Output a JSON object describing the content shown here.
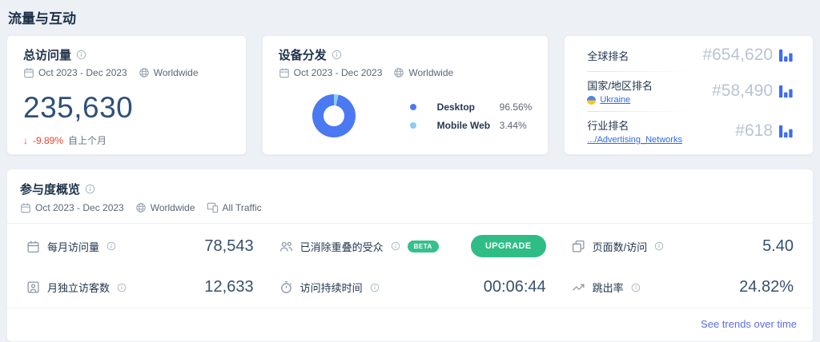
{
  "header": {
    "title": "流量与互动"
  },
  "total_visits": {
    "title": "总访问量",
    "date_range": "Oct 2023 - Dec 2023",
    "region": "Worldwide",
    "value": "235,630",
    "change_arrow": "↓",
    "change": "-9.89%",
    "change_caption": "自上个月"
  },
  "device_distribution": {
    "title": "设备分发",
    "date_range": "Oct 2023 - Dec 2023",
    "region": "Worldwide",
    "legend": [
      {
        "label": "Desktop",
        "value": "96.56%"
      },
      {
        "label": "Mobile Web",
        "value": "3.44%"
      }
    ]
  },
  "rankings": {
    "global": {
      "label": "全球排名",
      "value": "#654,620"
    },
    "country": {
      "label": "国家/地区排名",
      "link": "Ukraine",
      "value": "#58,490"
    },
    "industry": {
      "label": "行业排名",
      "link": ".../Advertising_Networks",
      "value": "#618"
    }
  },
  "engagement": {
    "title": "参与度概览",
    "date_range": "Oct 2023 - Dec 2023",
    "region": "Worldwide",
    "traffic_filter": "All Traffic",
    "metrics": {
      "monthly_visits": {
        "label": "每月访问量",
        "value": "78,543"
      },
      "deduplicated_audience": {
        "label": "已消除重叠的受众",
        "badge": "BETA",
        "action": "UPGRADE"
      },
      "pages_per_visit": {
        "label": "页面数/访问",
        "value": "5.40"
      },
      "monthly_unique_visitors": {
        "label": "月独立访客数",
        "value": "12,633"
      },
      "visit_duration": {
        "label": "访问持续时间",
        "value": "00:06:44"
      },
      "bounce_rate": {
        "label": "跳出率",
        "value": "24.82%"
      }
    },
    "footer_link": "See trends over time"
  },
  "chart_data": {
    "type": "pie",
    "donut": true,
    "title": "设备分发",
    "categories": [
      "Desktop",
      "Mobile Web"
    ],
    "values": [
      96.56,
      3.44
    ],
    "colors": [
      "#4a79f2",
      "#8ecbf5"
    ],
    "legend_position": "right"
  },
  "colors": {
    "accent_blue": "#3b6df0",
    "green": "#2ebd85",
    "red": "#e8452f",
    "link_blue": "#2e6be6",
    "trend_link": "#5b6ce0",
    "rank_value": "#b9c4d1"
  }
}
